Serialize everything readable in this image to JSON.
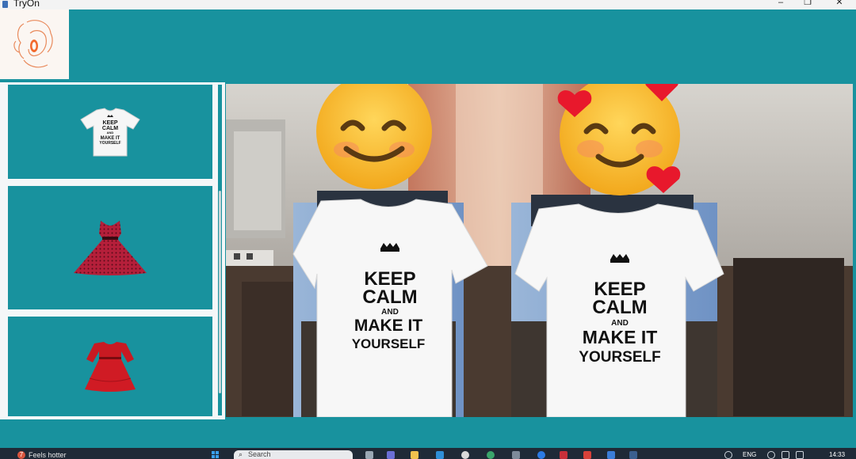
{
  "window": {
    "title": "TryOn",
    "controls": {
      "minimize": "–",
      "maximize": "❐",
      "close": "✕"
    }
  },
  "sidebar": {
    "items": [
      {
        "name": "keep-calm-tshirt",
        "shirt_text": [
          "KEEP",
          "CALM",
          "AND",
          "MAKE IT",
          "YOURSELF"
        ]
      },
      {
        "name": "red-polka-dot-dress"
      },
      {
        "name": "red-lace-dress"
      }
    ]
  },
  "camera": {
    "overlay_shirt": {
      "line1": "KEEP",
      "line2": "CALM",
      "line3": "AND",
      "line4": "MAKE IT",
      "line5": "YOURSELF"
    },
    "emojis": [
      "smiling-face-emoji",
      "smiling-face-with-hearts-emoji"
    ]
  },
  "taskbar": {
    "weather": {
      "badge": "7",
      "label": "Feels hotter"
    },
    "search_placeholder": "Search",
    "language": "ENG",
    "time": "14:33"
  }
}
